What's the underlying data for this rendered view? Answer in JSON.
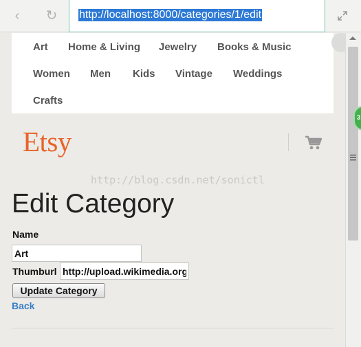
{
  "browser": {
    "address_url": "http://localhost:8000/categories/1/edit",
    "back_glyph": "‹",
    "reload_glyph": "↻"
  },
  "category_nav": {
    "items": [
      "Art",
      "Home & Living",
      "Jewelry",
      "Books & Music",
      "Women",
      "Men",
      "Kids",
      "Vintage",
      "Weddings",
      "Crafts"
    ]
  },
  "header": {
    "logo": "Etsy",
    "cart_icon": "cart-icon"
  },
  "watermark": "http://blog.csdn.net/sonictl",
  "form": {
    "title": "Edit Category",
    "name_label": "Name",
    "name_value": "Art",
    "thumburl_label": "Thumburl",
    "thumburl_value": "http://upload.wikimedia.org",
    "submit_label": "Update Category",
    "back_label": "Back"
  },
  "badge_text": "3",
  "colors": {
    "brand": "#e8642a",
    "link": "#3a7fc6",
    "selection": "#2d79d6",
    "badge": "#42b14c"
  }
}
